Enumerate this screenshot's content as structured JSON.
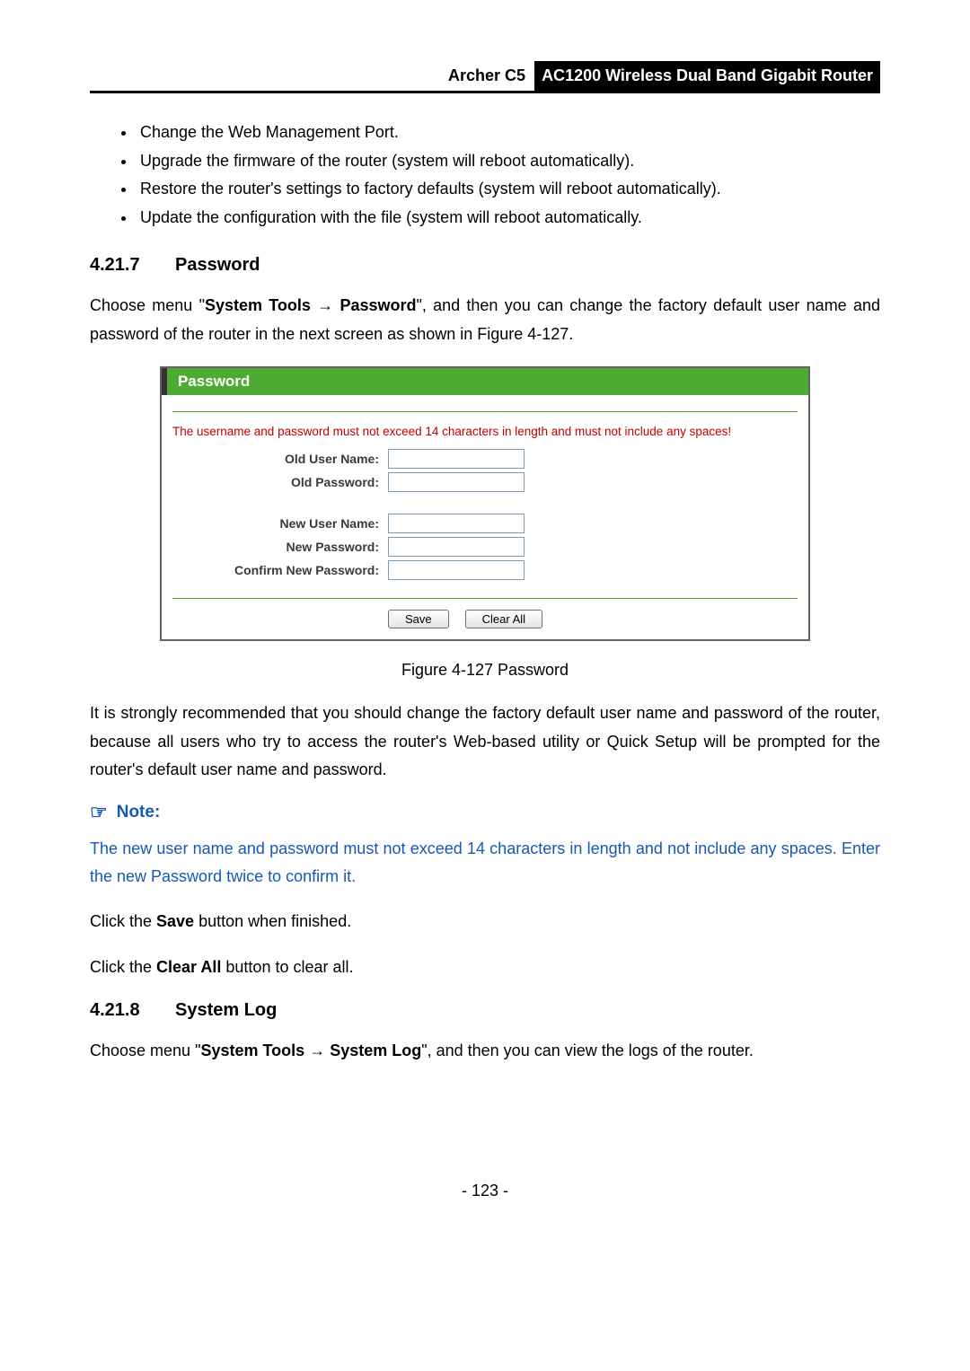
{
  "header": {
    "model": "Archer C5",
    "product": "AC1200 Wireless Dual Band Gigabit Router"
  },
  "bullets": [
    "Change the Web Management Port.",
    "Upgrade the firmware of the router (system will reboot automatically).",
    "Restore the router's settings to factory defaults (system will reboot automatically).",
    "Update the configuration with the file (system will reboot automatically."
  ],
  "sec1": {
    "num": "4.21.7",
    "title": "Password",
    "intro_pre": "Choose menu \"",
    "intro_bold1": "System Tools",
    "intro_arrow": " → ",
    "intro_bold2": "Password",
    "intro_post": "\", and then you can change the factory default user name and password of the router in the next screen as shown in Figure 4-127."
  },
  "routerui": {
    "title": "Password",
    "warn": "The username and password must not exceed 14 characters in length and must not include any spaces!",
    "old_user": "Old User Name:",
    "old_pass": "Old Password:",
    "new_user": "New User Name:",
    "new_pass": "New Password:",
    "confirm": "Confirm New Password:",
    "save": "Save",
    "clear": "Clear All"
  },
  "figcaption": "Figure 4-127 Password",
  "para_reco": "It is strongly recommended that you should change the factory default user name and password of the router, because all users who try to access the router's Web-based utility or Quick Setup will be prompted for the router's default user name and password.",
  "note_label": "Note:",
  "note_para": "The new user name and password must not exceed 14 characters in length and not include any spaces. Enter the new Password twice to confirm it.",
  "save_line_pre": "Click the ",
  "save_line_bold": "Save",
  "save_line_post": " button when finished.",
  "clear_line_pre": "Click the ",
  "clear_line_bold": "Clear All",
  "clear_line_post": " button to clear all.",
  "sec2": {
    "num": "4.21.8",
    "title": "System Log",
    "intro_pre": "Choose menu \"",
    "intro_bold1": "System Tools",
    "intro_arrow": " → ",
    "intro_bold2": "System Log",
    "intro_post": "\", and then you can view the logs of the router."
  },
  "page_number": "- 123 -"
}
